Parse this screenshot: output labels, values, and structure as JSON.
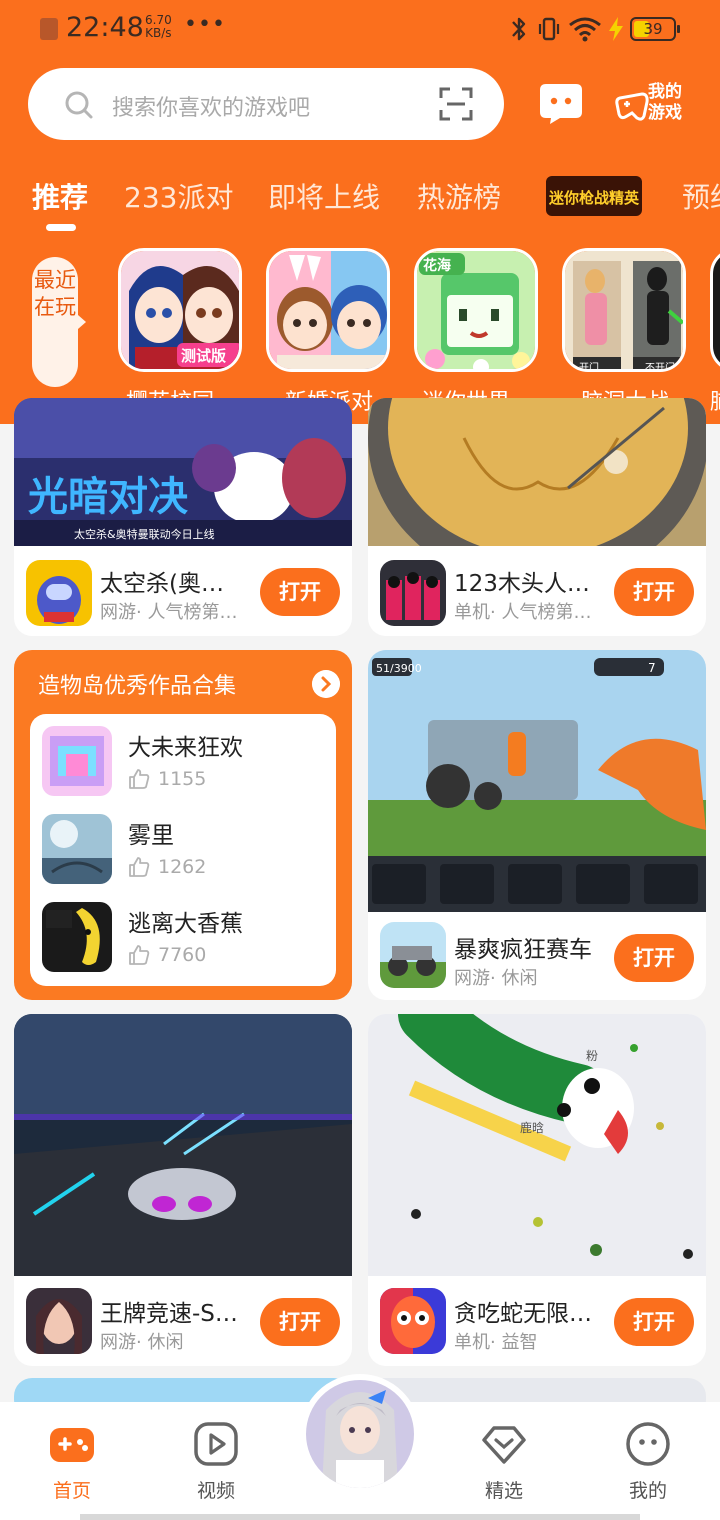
{
  "status_bar": {
    "time": "22:48",
    "speed_value": "6.70",
    "speed_unit": "KB/s",
    "dots": "•••",
    "battery": "39"
  },
  "search": {
    "placeholder": "搜索你喜欢的游戏吧"
  },
  "header": {
    "my_games_label": "我的游戏"
  },
  "tabs": [
    {
      "label": "推荐",
      "active": true
    },
    {
      "label": "233派对"
    },
    {
      "label": "即将上线"
    },
    {
      "label": "热游榜"
    },
    {
      "label": "迷你枪战精英",
      "logo": true
    },
    {
      "label": "预约"
    }
  ],
  "recent": {
    "tag_label": "最近在玩",
    "apps": [
      {
        "label": "樱花校园…",
        "badge": "测试版"
      },
      {
        "label": "新婚派对"
      },
      {
        "label": "迷你世界…",
        "badge": "花海"
      },
      {
        "label": "脑洞大战",
        "sign_left": "开门",
        "sign_right": "不开门"
      }
    ],
    "partial_label": "脑"
  },
  "feed": {
    "cards": [
      {
        "name": "太空杀(奥…",
        "sub": "网游· 人气榜第…",
        "button": "打开",
        "banner_title": "光暗对决",
        "banner_sub": "太空杀&奥特曼联动今日上线"
      },
      {
        "name": "123木头人…",
        "sub": "单机· 人气榜第…",
        "button": "打开"
      },
      {
        "name": "暴爽疯狂赛车",
        "sub": "网游· 休闲",
        "button": "打开",
        "hud_left": "51/3900",
        "hud_right": "7"
      },
      {
        "name": "王牌竞速-S…",
        "sub": "网游· 休闲",
        "button": "打开"
      },
      {
        "name": "贪吃蛇无限…",
        "sub": "单机· 益智",
        "button": "打开",
        "snake_label_1": "鹿晗",
        "snake_label_2": "粉"
      }
    ],
    "collection": {
      "title": "造物岛优秀作品合集",
      "items": [
        {
          "name": "大未来狂欢",
          "likes": "1155"
        },
        {
          "name": "雾里",
          "likes": "1262"
        },
        {
          "name": "逃离大香蕉",
          "likes": "7760"
        }
      ]
    }
  },
  "bottom_nav": [
    {
      "label": "首页",
      "icon": "gamepad-icon",
      "active": true
    },
    {
      "label": "视频",
      "icon": "play-icon"
    },
    {
      "label": "精选",
      "icon": "heart-diamond-icon"
    },
    {
      "label": "我的",
      "icon": "smiley-icon"
    }
  ],
  "colors": {
    "brand_orange": "#fb6f1d",
    "background": "#f4f4f4"
  }
}
